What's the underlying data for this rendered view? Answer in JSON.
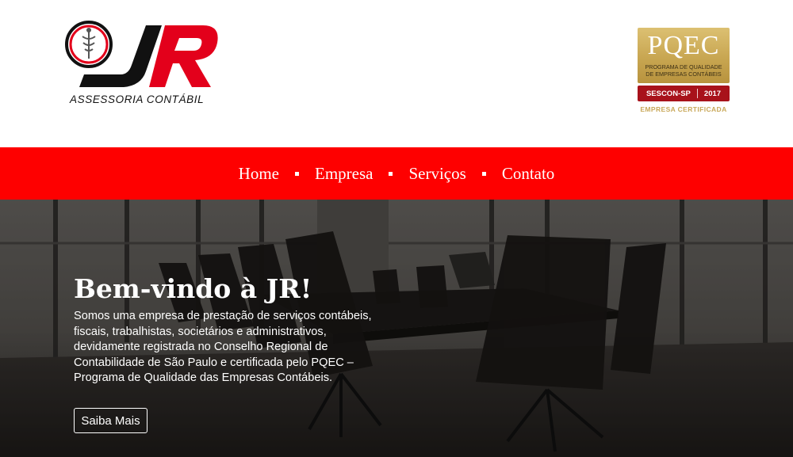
{
  "header": {
    "logo": {
      "letters": "JR",
      "tagline": "ASSESSORIA CONTÁBIL",
      "colors": {
        "black": "#111111",
        "red": "#e3001b"
      }
    },
    "badge": {
      "title": "PQEC",
      "subtitle_line1": "PROGRAMA DE QUALIDADE",
      "subtitle_line2": "DE EMPRESAS CONTÁBEIS",
      "org": "SESCON-SP",
      "year": "2017",
      "certified": "EMPRESA CERTIFICADA",
      "colors": {
        "gold": "#c8a651",
        "red": "#a8121b"
      }
    }
  },
  "nav": {
    "background": "#fe0000",
    "items": [
      {
        "label": "Home"
      },
      {
        "label": "Empresa"
      },
      {
        "label": "Serviços"
      },
      {
        "label": "Contato"
      }
    ]
  },
  "hero": {
    "title": "Bem-vindo à JR!",
    "text": "Somos uma empresa de prestação de serviços contábeis, fiscais, trabalhistas, societários e administrativos, devidamente registrada no Conselho Regional de Contabilidade de São Paulo e certificada pelo PQEC – Programa de Qualidade das Empresas Contábeis.",
    "button_label": "Saiba Mais",
    "background_image": "conference-room-photo"
  }
}
